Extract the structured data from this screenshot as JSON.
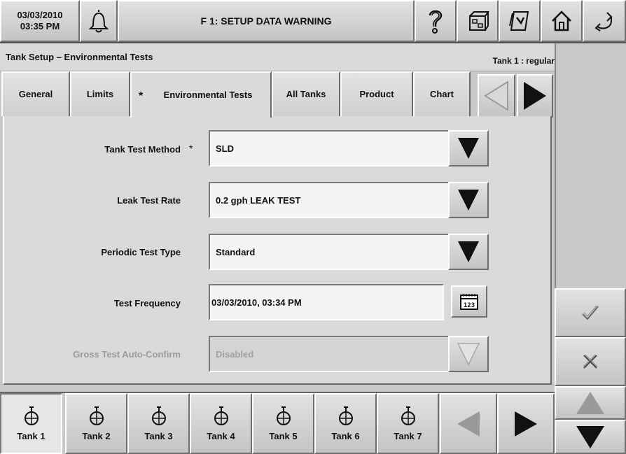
{
  "topbar": {
    "date": "03/03/2010",
    "time": "03:35 PM",
    "title": "F 1: SETUP DATA WARNING"
  },
  "icons": {
    "alarm": "bell-icon",
    "help": "help-question-icon",
    "setup": "setup-icon",
    "reports": "report-printer-icon",
    "home": "home-icon",
    "back": "back-arrow-icon"
  },
  "header": {
    "section_title": "Tank Setup – Environmental Tests",
    "tank_label": "Tank 1 : regular"
  },
  "tabs": [
    {
      "label": "General",
      "active": false
    },
    {
      "label": "Limits",
      "active": false
    },
    {
      "label": "Environmental Tests",
      "active": true,
      "modified_marker": "*"
    },
    {
      "label": "All Tanks",
      "active": false
    },
    {
      "label": "Product",
      "active": false
    },
    {
      "label": "Chart",
      "active": false
    }
  ],
  "form": {
    "tank_test_method": {
      "label": "Tank Test Method",
      "required_marker": "*",
      "value": "SLD"
    },
    "leak_test_rate": {
      "label": "Leak Test Rate",
      "value": "0.2 gph LEAK TEST"
    },
    "periodic_test_type": {
      "label": "Periodic Test Type",
      "value": "Standard"
    },
    "test_frequency": {
      "label": "Test Frequency",
      "value": "03/03/2010, 03:34 PM"
    },
    "gross_test_auto_confirm": {
      "label": "Gross Test Auto-Confirm",
      "value": "Disabled",
      "disabled": true
    }
  },
  "tanks": [
    {
      "label": "Tank 1",
      "active": true
    },
    {
      "label": "Tank 2",
      "active": false
    },
    {
      "label": "Tank 3",
      "active": false
    },
    {
      "label": "Tank 4",
      "active": false
    },
    {
      "label": "Tank 5",
      "active": false
    },
    {
      "label": "Tank 6",
      "active": false
    },
    {
      "label": "Tank 7",
      "active": false
    }
  ],
  "colors": {
    "panel": "#c8c8c8",
    "content": "#dadada",
    "field": "#f4f4f4",
    "disabled_text": "#9a9a9a"
  }
}
